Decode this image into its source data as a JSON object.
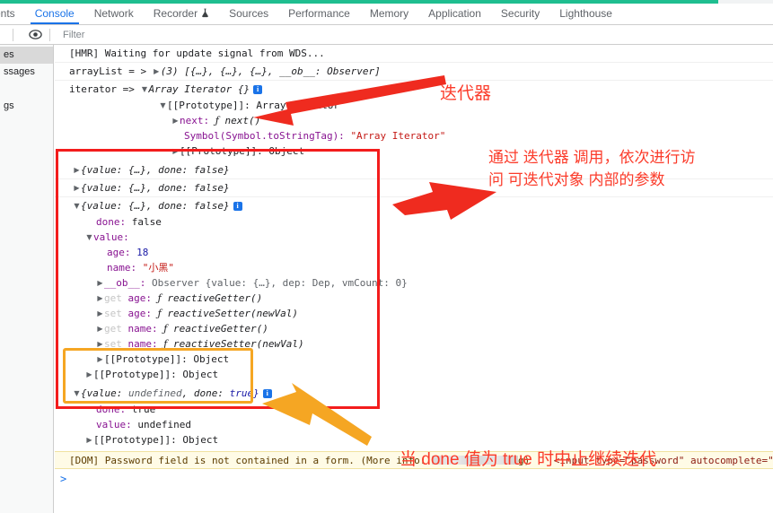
{
  "window": {
    "accent_color": "#1fbe90"
  },
  "tabs": [
    {
      "label": "ents",
      "name": "tab-elements",
      "cut": true,
      "active": false
    },
    {
      "label": "Console",
      "name": "tab-console",
      "cut": false,
      "active": true
    },
    {
      "label": "Network",
      "name": "tab-network",
      "cut": false,
      "active": false
    },
    {
      "label": "Recorder",
      "name": "tab-recorder",
      "cut": false,
      "active": false,
      "icon": "flask-icon"
    },
    {
      "label": "Sources",
      "name": "tab-sources",
      "cut": false,
      "active": false
    },
    {
      "label": "Performance",
      "name": "tab-performance",
      "cut": false,
      "active": false
    },
    {
      "label": "Memory",
      "name": "tab-memory",
      "cut": false,
      "active": false
    },
    {
      "label": "Application",
      "name": "tab-application",
      "cut": false,
      "active": false
    },
    {
      "label": "Security",
      "name": "tab-security",
      "cut": false,
      "active": false
    },
    {
      "label": "Lighthouse",
      "name": "tab-lighthouse",
      "cut": false,
      "active": false
    }
  ],
  "toolbar": {
    "eye_icon": "eye-icon",
    "filter_placeholder": "Filter",
    "filter_value": ""
  },
  "sidebar": {
    "items": [
      {
        "label": "es",
        "selected": true
      },
      {
        "label": "ssages",
        "selected": false
      },
      {
        "label": "gs",
        "selected": false
      }
    ]
  },
  "console": {
    "hmr_line": "[HMR] Waiting for update signal from WDS...",
    "arraylist_label": "arrayList = >",
    "arraylist_value": "(3) [{…}, {…}, {…}, __ob__: Observer]",
    "iterator_label": "iterator =>",
    "iterator_value": "Array Iterator {}",
    "proto_array_iterator": "[[Prototype]]: Array Iterator",
    "next_prop": "next:",
    "next_fn": "next()",
    "symbol_key": "Symbol(Symbol.toStringTag):",
    "symbol_value": "\"Array Iterator\"",
    "proto_object": "[[Prototype]]: Object",
    "result_rows": [
      {
        "summary": "{value: {…}, done: false}",
        "expanded": false
      },
      {
        "summary": "{value: {…}, done: false}",
        "expanded": false
      },
      {
        "summary": "{value: {…}, done: false}",
        "expanded": true
      }
    ],
    "expanded_detail": {
      "done_key": "done:",
      "done_value": "false",
      "value_key": "value:",
      "age_key": "age:",
      "age_value": "18",
      "name_key": "name:",
      "name_value": "\"小黑\"",
      "ob_key": "__ob__:",
      "ob_value": "Observer {value: {…}, dep: Dep, vmCount: 0}",
      "accessors": [
        {
          "kind": "get",
          "prop": "age:",
          "fn": "reactiveGetter()"
        },
        {
          "kind": "set",
          "prop": "age:",
          "fn": "reactiveSetter(newVal)"
        },
        {
          "kind": "get",
          "prop": "name:",
          "fn": "reactiveGetter()"
        },
        {
          "kind": "set",
          "prop": "name:",
          "fn": "reactiveSetter(newVal)"
        }
      ],
      "inner_proto": "[[Prototype]]: Object",
      "outer_proto": "[[Prototype]]: Object"
    },
    "done_row": {
      "summary_a": "{value:",
      "summary_b": "undefined",
      "summary_c": ", done:",
      "summary_d": "true}",
      "done_key": "done:",
      "done_value": "true",
      "value_key": "value:",
      "value_value": "undefined",
      "proto": "[[Prototype]]: Object"
    },
    "dom_warning": {
      "prefix": "[DOM] Password field is not contained in a form. (More info:",
      "redacted": "",
      "suffix": "g)",
      "markup": "<input type=\"password\" autocomplete=\"on\" name="
    },
    "prompt": ">"
  },
  "annotations": {
    "iterator_note": "迭代器",
    "usage_note_line1": "通过 迭代器 调用，依次进行访",
    "usage_note_line2": "问 可迭代对象 内部的参数",
    "done_note": "当 done 值为 true 时中止继续迭代",
    "red_color": "#fb3b2a",
    "orange_color": "#f5a623"
  }
}
